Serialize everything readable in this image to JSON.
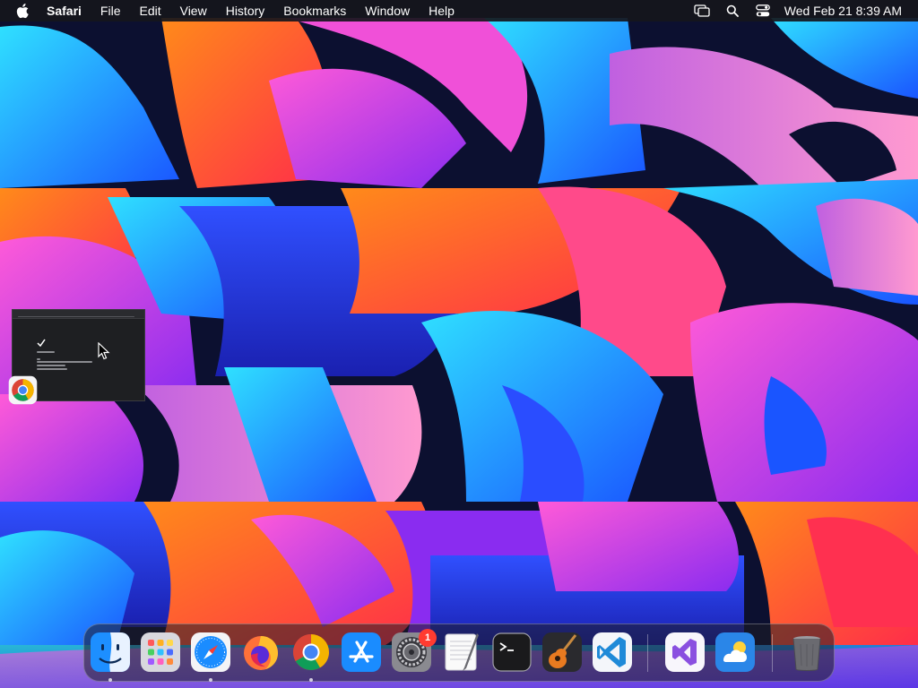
{
  "menubar": {
    "app_name": "Safari",
    "items": [
      "File",
      "Edit",
      "View",
      "History",
      "Bookmarks",
      "Window",
      "Help"
    ],
    "clock": "Wed Feb 21  8:39 AM",
    "status_icons": [
      "screen-mirroring-icon",
      "spotlight-search-icon",
      "control-center-icon"
    ]
  },
  "minimized_window": {
    "app_icon": "chrome-icon"
  },
  "dock": {
    "badge_count": "1",
    "items": [
      {
        "name": "finder",
        "running": true
      },
      {
        "name": "launchpad",
        "running": false
      },
      {
        "name": "safari",
        "running": true
      },
      {
        "name": "firefox",
        "running": false
      },
      {
        "name": "chrome",
        "running": true
      },
      {
        "name": "app-store",
        "running": false
      },
      {
        "name": "system-settings",
        "running": false
      },
      {
        "name": "textedit",
        "running": false
      },
      {
        "name": "terminal",
        "running": false
      },
      {
        "name": "garageband",
        "running": false
      },
      {
        "name": "vscode",
        "running": false
      },
      {
        "name": "visual-studio",
        "running": false
      },
      {
        "name": "weather",
        "running": false
      },
      {
        "name": "trash",
        "running": false
      }
    ]
  },
  "colors": {
    "wallpaper_base": "#0c1030",
    "orange": "#ff6a1a",
    "magenta": "#e040e8",
    "cyan": "#22c6f0",
    "blue": "#2a4dff",
    "purple": "#8a2cf0"
  }
}
